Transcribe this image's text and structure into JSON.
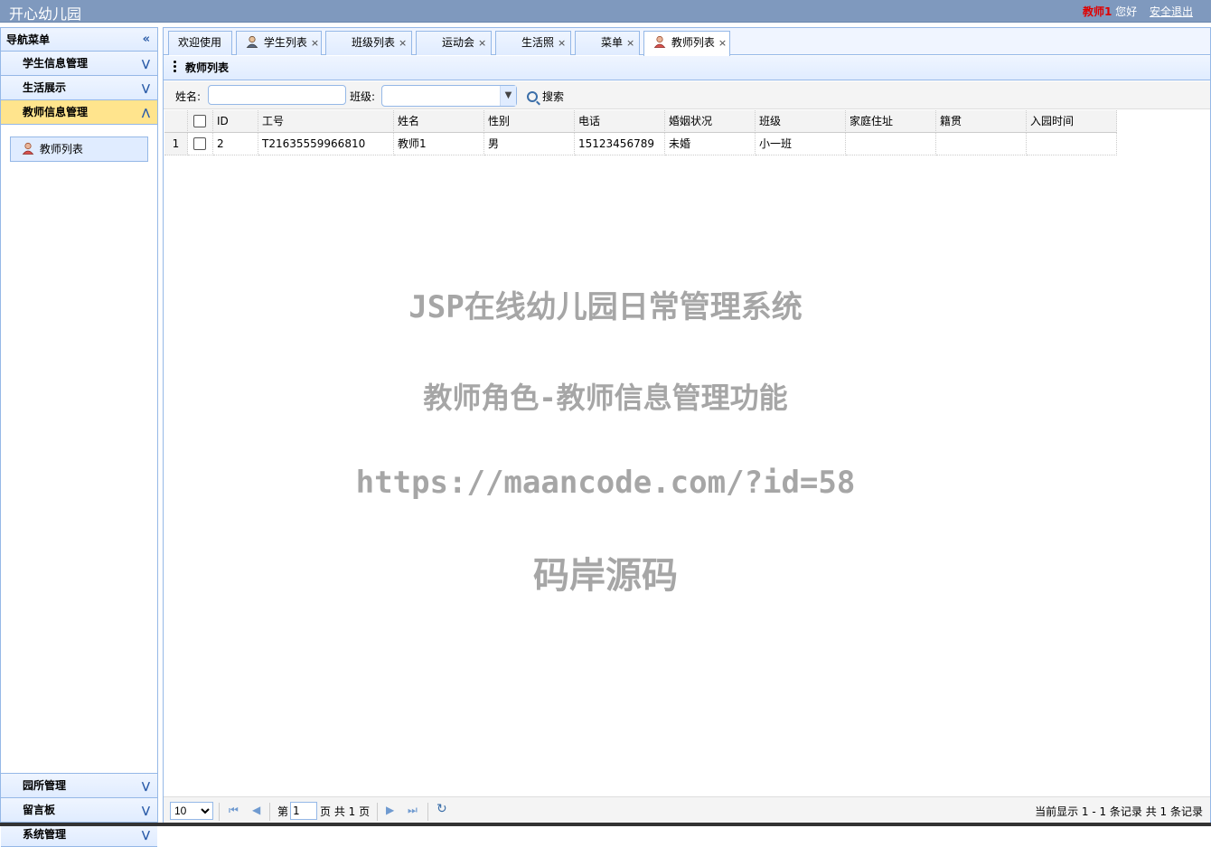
{
  "header": {
    "app_title": "开心幼儿园",
    "user_name": "教师1",
    "greeting": "您好",
    "logout": "安全退出"
  },
  "sidebar": {
    "title": "导航菜单",
    "sections": [
      {
        "label": "学生信息管理"
      },
      {
        "label": "生活展示"
      },
      {
        "label": "教师信息管理"
      }
    ],
    "active_item": "教师列表",
    "bottom_sections": [
      {
        "label": "园所管理"
      },
      {
        "label": "留言板"
      },
      {
        "label": "系统管理"
      }
    ]
  },
  "tabs": [
    {
      "label": "欢迎使用"
    },
    {
      "label": "学生列表"
    },
    {
      "label": "班级列表"
    },
    {
      "label": "运动会"
    },
    {
      "label": "生活照"
    },
    {
      "label": "菜单"
    },
    {
      "label": "教师列表"
    }
  ],
  "panel": {
    "title": "教师列表"
  },
  "search": {
    "name_label": "姓名:",
    "name_value": "",
    "class_label": "班级:",
    "class_value": "",
    "search_button": "搜索"
  },
  "grid": {
    "columns": [
      "ID",
      "工号",
      "姓名",
      "性别",
      "电话",
      "婚姻状况",
      "班级",
      "家庭住址",
      "籍贯",
      "入园时间"
    ],
    "rows": [
      {
        "num": "1",
        "cells": [
          "2",
          "T21635559966810",
          "教师1",
          "男",
          "15123456789",
          "未婚",
          "小一班",
          "",
          "",
          ""
        ]
      }
    ]
  },
  "watermark": {
    "line1": "JSP在线幼儿园日常管理系统",
    "line2": "教师角色-教师信息管理功能",
    "line3": "https://maancode.com/?id=58",
    "line4": "码岸源码"
  },
  "pager": {
    "page_size": "10",
    "page_prefix": "第",
    "page_value": "1",
    "page_suffix": "页 共 1 页",
    "info": "当前显示 1 - 1 条记录 共 1 条记录"
  }
}
